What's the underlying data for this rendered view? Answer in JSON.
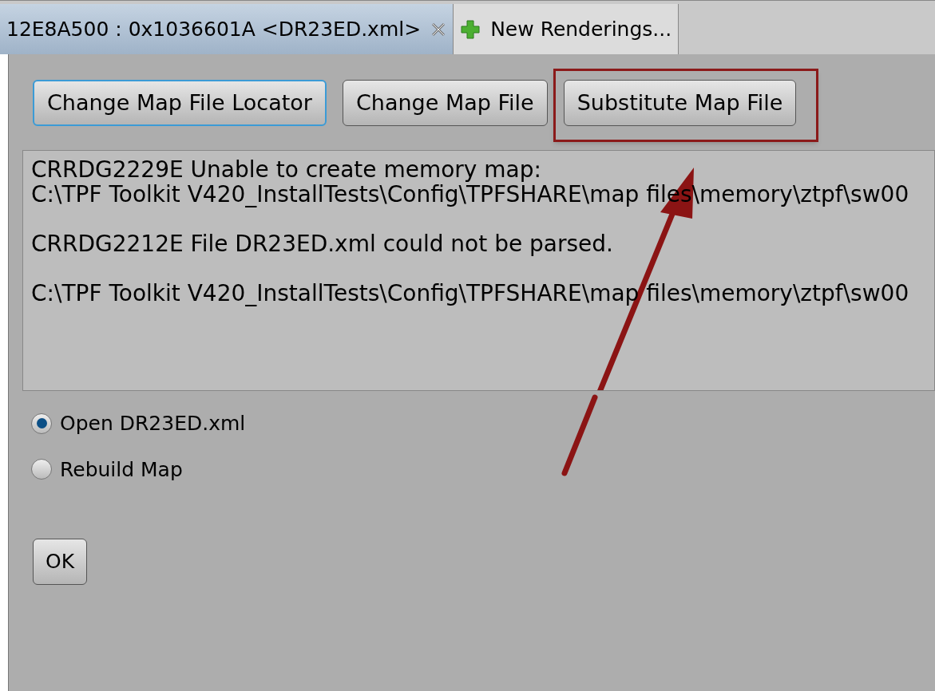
{
  "tabs": [
    {
      "label": "12E8A500 : 0x1036601A <DR23ED.xml>",
      "selected": true,
      "closable": true
    },
    {
      "label": "New Renderings...",
      "selected": false,
      "closable": false
    }
  ],
  "buttons": [
    {
      "label": "Change Map File Locator",
      "focused": true,
      "highlighted": false
    },
    {
      "label": "Change Map File",
      "focused": false,
      "highlighted": false
    },
    {
      "label": "Substitute Map File",
      "focused": false,
      "highlighted": true
    }
  ],
  "messages": [
    {
      "lines": [
        "CRRDG2229E Unable to create memory map:",
        "C:\\TPF Toolkit V420_InstallTests\\Config\\TPFSHARE\\map files\\memory\\ztpf\\sw00"
      ]
    },
    {
      "lines": [
        "CRRDG2212E File DR23ED.xml could not be parsed."
      ]
    },
    {
      "lines": [
        "C:\\TPF Toolkit V420_InstallTests\\Config\\TPFSHARE\\map files\\memory\\ztpf\\sw00"
      ]
    }
  ],
  "options": [
    {
      "label": "Open DR23ED.xml",
      "selected": true
    },
    {
      "label": "Rebuild Map",
      "selected": false
    }
  ],
  "ok_button": "OK"
}
